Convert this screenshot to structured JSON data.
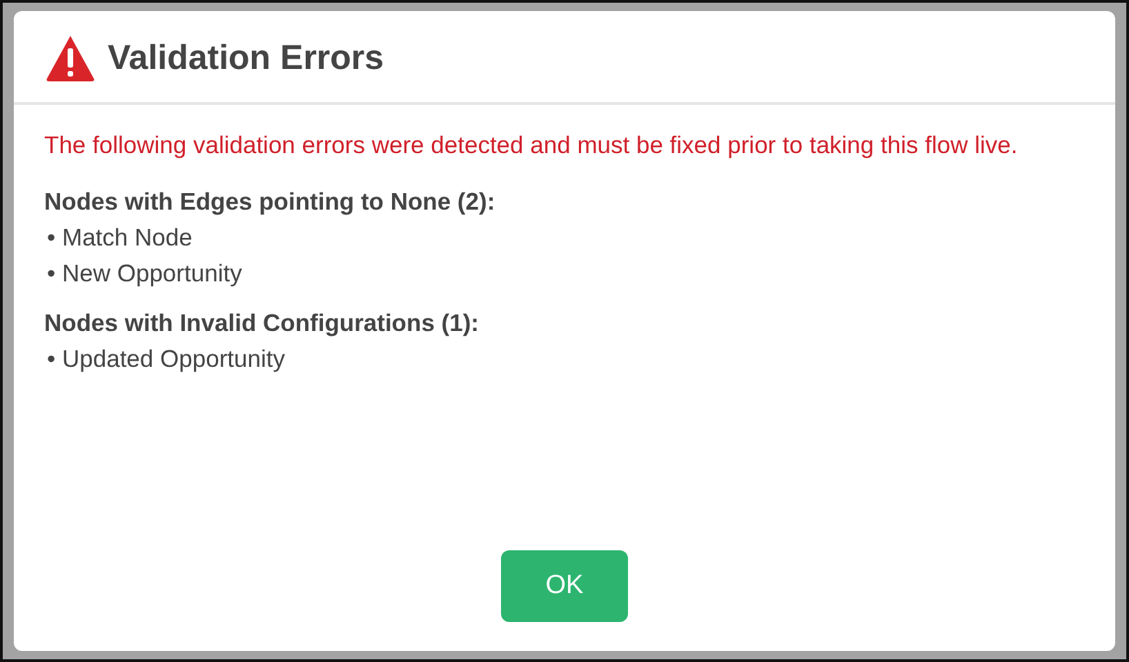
{
  "dialog": {
    "title": "Validation Errors",
    "message": "The following validation errors were detected and must be fixed prior to taking this flow live.",
    "groups": [
      {
        "heading": "Nodes with Edges pointing to None (2):",
        "items": [
          "• Match Node",
          "• New Opportunity"
        ]
      },
      {
        "heading": "Nodes with Invalid Configurations (1):",
        "items": [
          "• Updated Opportunity"
        ]
      }
    ],
    "buttons": [
      "OK"
    ]
  }
}
